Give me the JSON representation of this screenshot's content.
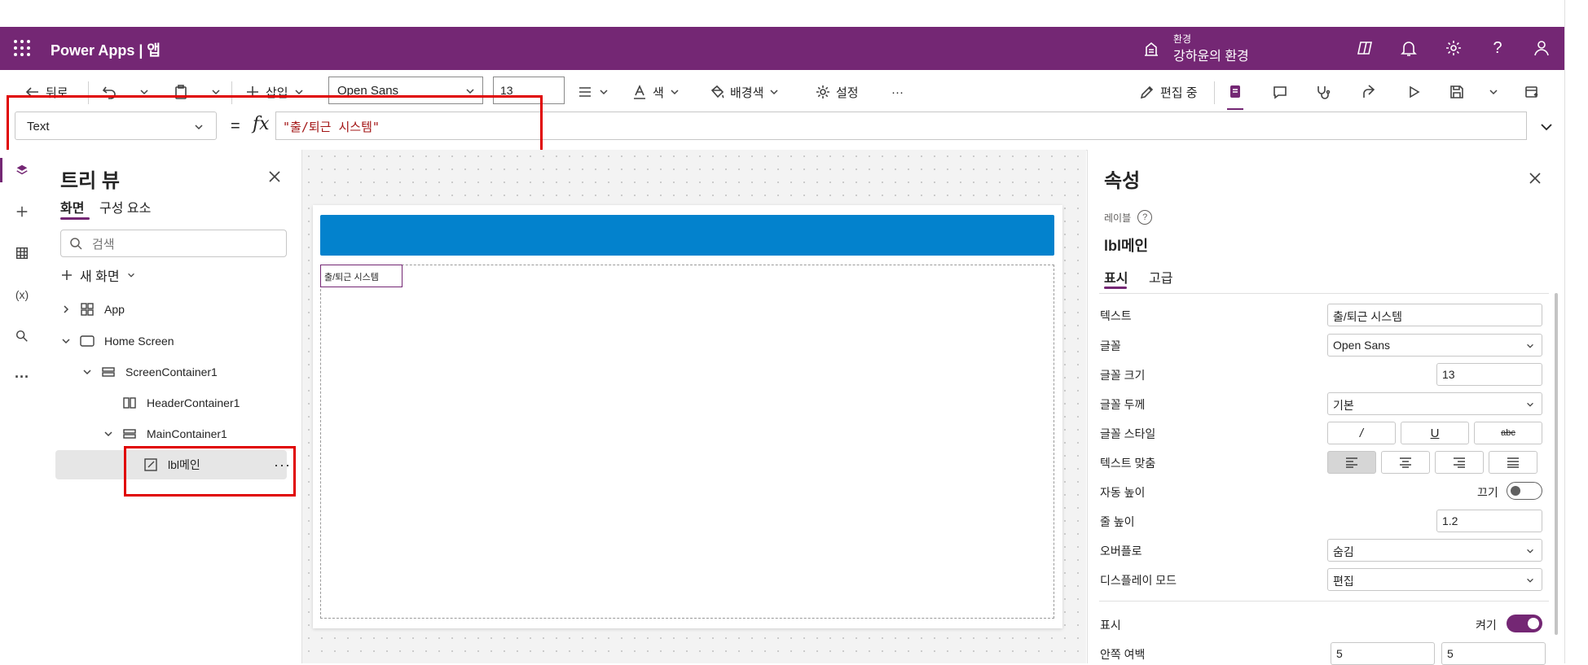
{
  "topbar": {
    "app_title": "Power Apps  |  앱",
    "env_label": "환경",
    "env_name": "강하윤의 환경",
    "icons": [
      "copilot-icon",
      "bell-icon",
      "gear-icon",
      "help-icon",
      "person-icon"
    ]
  },
  "commandbar": {
    "back": "뒤로",
    "insert": "삽입",
    "font": "Open Sans",
    "font_size": "13",
    "color": "색",
    "fill": "배경색",
    "settings": "설정",
    "more": "···",
    "editing": "편집 중"
  },
  "formula": {
    "property": "Text",
    "equals": "=",
    "fx": "fx",
    "value": "\"출/퇴근 시스템\""
  },
  "tree": {
    "title": "트리 뷰",
    "tab_screens": "화면",
    "tab_components": "구성 요소",
    "search_placeholder": "검색",
    "new_screen": "새 화면",
    "nodes": {
      "app": "App",
      "home_screen": "Home Screen",
      "screen_container": "ScreenContainer1",
      "header_container": "HeaderContainer1",
      "main_container": "MainContainer1",
      "lbl_main": "lbl메인"
    },
    "more": "···"
  },
  "canvas": {
    "label_text": "출/퇴근 시스템"
  },
  "properties": {
    "title": "속성",
    "control_type": "레이블",
    "control_name": "lbl메인",
    "tab_display": "표시",
    "tab_advanced": "고급",
    "rows": {
      "text_label": "텍스트",
      "text_value": "출/퇴근 시스템",
      "font_label": "글꼴",
      "font_value": "Open Sans",
      "size_label": "글꼴 크기",
      "size_value": "13",
      "weight_label": "글꼴 두께",
      "weight_value": "기본",
      "style_label": "글꼴 스타일",
      "style_italic": "/",
      "style_underline": "U",
      "style_strike": "abc",
      "align_label": "텍스트 맞춤",
      "autoheight_label": "자동 높이",
      "autoheight_state": "끄기",
      "lineheight_label": "줄 높이",
      "lineheight_value": "1.2",
      "overflow_label": "오버플로",
      "overflow_value": "숨김",
      "displaymode_label": "디스플레이 모드",
      "displaymode_value": "편집",
      "visible_label": "표시",
      "visible_state": "켜기",
      "padding_label": "안쪽 여백",
      "padding_top": "5",
      "padding_bottom": "5"
    }
  },
  "colors": {
    "brand": "#742774",
    "header_fill": "#0382cd",
    "highlight": "#e00000"
  }
}
